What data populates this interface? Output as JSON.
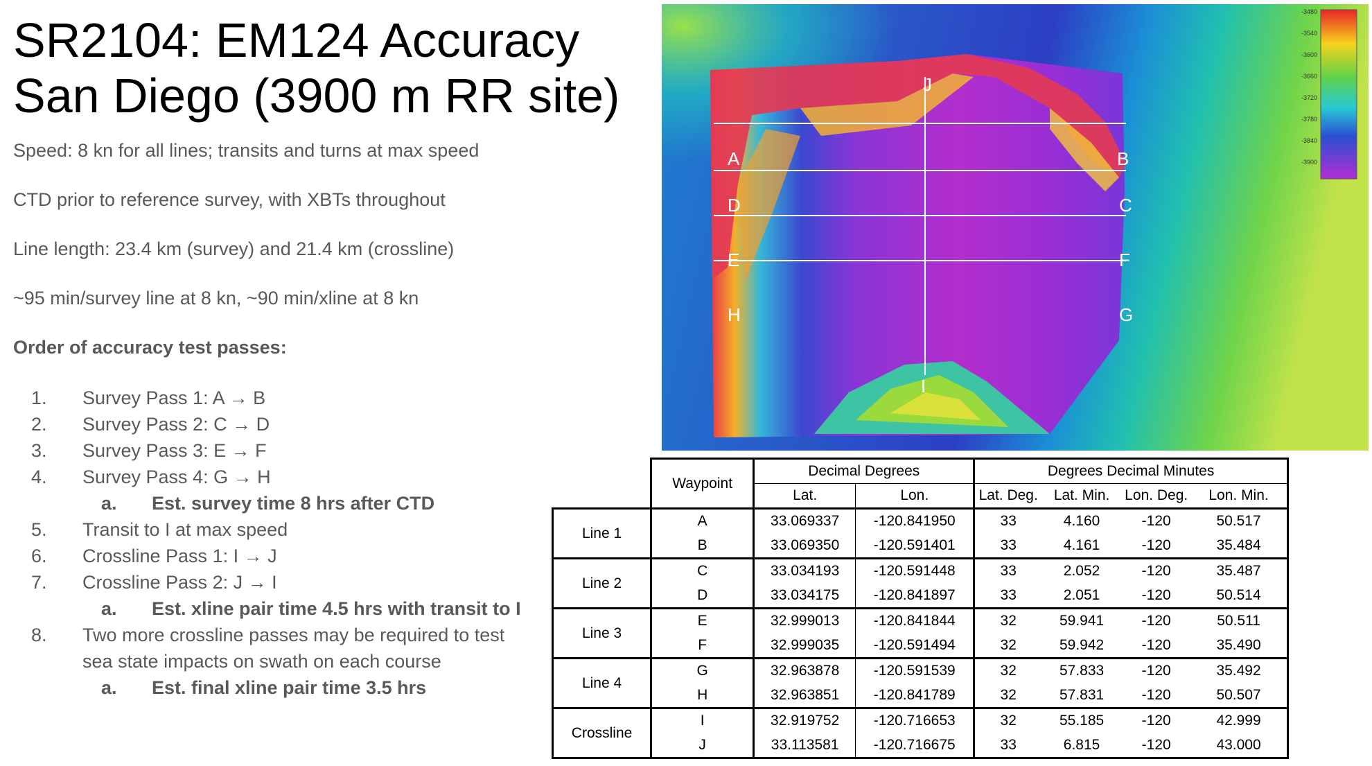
{
  "title": {
    "line1": "SR2104: EM124 Accuracy",
    "line2": "San Diego (3900 m RR site)"
  },
  "notes": {
    "speed": "Speed: 8 kn for all lines; transits and turns at max speed",
    "ctd": "CTD prior to reference survey, with XBTs throughout",
    "length": "Line length: 23.4 km (survey) and 21.4 km (crossline)",
    "time": "~95 min/survey line at 8 kn, ~90 min/xline at 8 kn",
    "order_heading": "Order of accuracy test passes:"
  },
  "steps": [
    {
      "num": "1.",
      "text": "Survey Pass 1: A → B"
    },
    {
      "num": "2.",
      "text": "Survey Pass 2: C → D"
    },
    {
      "num": "3.",
      "text": "Survey Pass 3: E → F"
    },
    {
      "num": "4.",
      "text": "Survey Pass 4: G → H"
    },
    {
      "num": "a.",
      "text": "Est. survey time 8 hrs after CTD"
    },
    {
      "num": "5.",
      "text": "Transit to I at max speed"
    },
    {
      "num": "6.",
      "text": "Crossline Pass 1: I → J"
    },
    {
      "num": "7.",
      "text": "Crossline Pass 2: J → I"
    },
    {
      "num": "a.",
      "text": "Est. xline pair time 4.5 hrs with transit to I"
    },
    {
      "num": "8.",
      "text": "Two more crossline passes may be required to test sea state impacts on swath on each course"
    },
    {
      "num": "a.",
      "text": "Est. final xline pair time 3.5 hrs"
    }
  ],
  "map": {
    "colorbar_ticks": [
      "-3480",
      "-3540",
      "-3600",
      "-3660",
      "-3720",
      "-3780",
      "-3840",
      "-3900"
    ],
    "point_labels": [
      "A",
      "B",
      "C",
      "D",
      "E",
      "F",
      "G",
      "H",
      "I",
      "J"
    ]
  },
  "table": {
    "headers": {
      "waypoint": "Waypoint",
      "decimal_degrees": "Decimal Degrees",
      "ddm": "Degrees Decimal Minutes",
      "lat": "Lat.",
      "lon": "Lon.",
      "lat_deg": "Lat. Deg.",
      "lat_min": "Lat. Min.",
      "lon_deg": "Lon. Deg.",
      "lon_min": "Lon. Min."
    },
    "groups": [
      {
        "name": "Line 1",
        "rows": [
          {
            "wp": "A",
            "lat": "33.069337",
            "lon": "-120.841950",
            "lat_deg": "33",
            "lat_min": "4.160",
            "lon_deg": "-120",
            "lon_min": "50.517"
          },
          {
            "wp": "B",
            "lat": "33.069350",
            "lon": "-120.591401",
            "lat_deg": "33",
            "lat_min": "4.161",
            "lon_deg": "-120",
            "lon_min": "35.484"
          }
        ]
      },
      {
        "name": "Line 2",
        "rows": [
          {
            "wp": "C",
            "lat": "33.034193",
            "lon": "-120.591448",
            "lat_deg": "33",
            "lat_min": "2.052",
            "lon_deg": "-120",
            "lon_min": "35.487"
          },
          {
            "wp": "D",
            "lat": "33.034175",
            "lon": "-120.841897",
            "lat_deg": "33",
            "lat_min": "2.051",
            "lon_deg": "-120",
            "lon_min": "50.514"
          }
        ]
      },
      {
        "name": "Line 3",
        "rows": [
          {
            "wp": "E",
            "lat": "32.999013",
            "lon": "-120.841844",
            "lat_deg": "32",
            "lat_min": "59.941",
            "lon_deg": "-120",
            "lon_min": "50.511"
          },
          {
            "wp": "F",
            "lat": "32.999035",
            "lon": "-120.591494",
            "lat_deg": "32",
            "lat_min": "59.942",
            "lon_deg": "-120",
            "lon_min": "35.490"
          }
        ]
      },
      {
        "name": "Line 4",
        "rows": [
          {
            "wp": "G",
            "lat": "32.963878",
            "lon": "-120.591539",
            "lat_deg": "32",
            "lat_min": "57.833",
            "lon_deg": "-120",
            "lon_min": "35.492"
          },
          {
            "wp": "H",
            "lat": "32.963851",
            "lon": "-120.841789",
            "lat_deg": "32",
            "lat_min": "57.831",
            "lon_deg": "-120",
            "lon_min": "50.507"
          }
        ]
      },
      {
        "name": "Crossline",
        "rows": [
          {
            "wp": "I",
            "lat": "32.919752",
            "lon": "-120.716653",
            "lat_deg": "32",
            "lat_min": "55.185",
            "lon_deg": "-120",
            "lon_min": "42.999"
          },
          {
            "wp": "J",
            "lat": "33.113581",
            "lon": "-120.716675",
            "lat_deg": "33",
            "lat_min": "6.815",
            "lon_deg": "-120",
            "lon_min": "43.000"
          }
        ]
      }
    ]
  }
}
